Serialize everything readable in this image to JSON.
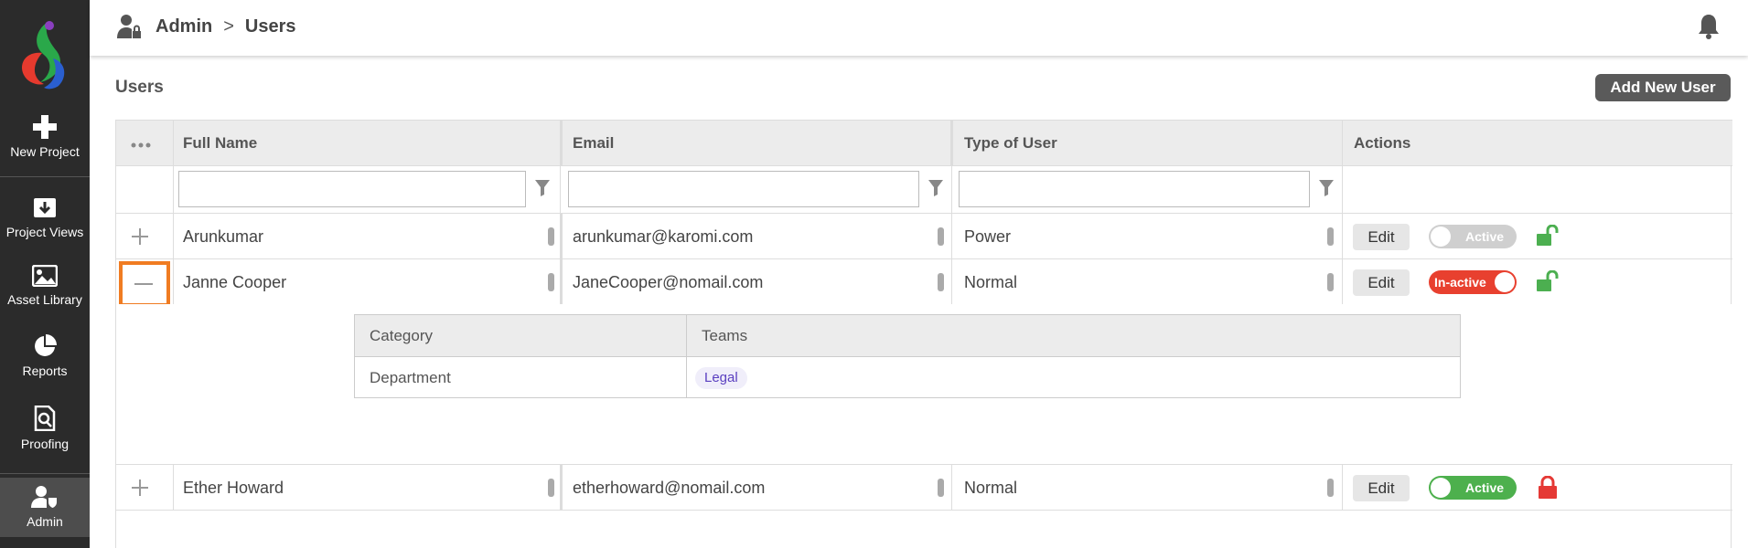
{
  "nav": {
    "items": [
      {
        "label": "New Project",
        "icon": "plus-icon"
      },
      {
        "label": "Project Views",
        "icon": "download-box-icon"
      },
      {
        "label": "Asset Library",
        "icon": "image-icon"
      },
      {
        "label": "Reports",
        "icon": "pie-chart-icon"
      },
      {
        "label": "Proofing",
        "icon": "document-search-icon"
      },
      {
        "label": "Admin",
        "icon": "user-shield-icon"
      }
    ]
  },
  "header": {
    "breadcrumb_root": "Admin",
    "breadcrumb_sep": ">",
    "breadcrumb_current": "Users"
  },
  "page": {
    "title": "Users",
    "add_button": "Add New User"
  },
  "table": {
    "columns": [
      "Full Name",
      "Email",
      "Type of User",
      "Actions"
    ],
    "edit_label": "Edit",
    "rows": [
      {
        "name": "Arunkumar",
        "email": "arunkumar@karomi.com",
        "type": "Power",
        "status": "Active",
        "locked": false
      },
      {
        "name": "Janne Cooper",
        "email": "JaneCooper@nomail.com",
        "type": "Normal",
        "status": "In-active",
        "locked": false
      },
      {
        "name": "Ether Howard",
        "email": "etherhoward@nomail.com",
        "type": "Normal",
        "status": "Active",
        "locked": true
      }
    ],
    "detail": {
      "headers": [
        "Category",
        "Teams"
      ],
      "category": "Department",
      "team": "Legal"
    }
  },
  "colors": {
    "sidebar": "#2b2b2b",
    "focus_outline": "#f07c22",
    "inactive_toggle": "#e8402f",
    "active_toggle": "#4db04d",
    "unlocked": "#4caf50",
    "locked": "#e53935"
  }
}
